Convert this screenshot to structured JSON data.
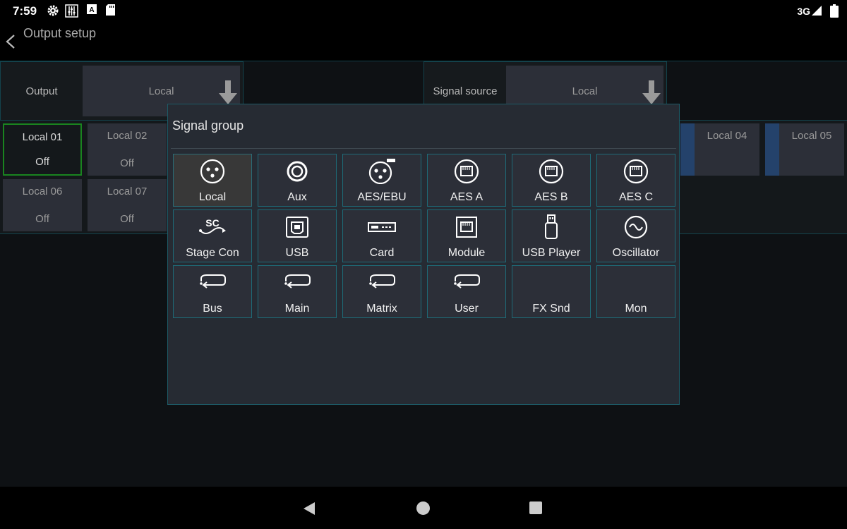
{
  "status_bar": {
    "time": "7:59",
    "network": "3G",
    "icons": [
      "gear-icon",
      "mixer-icon",
      "a-icon",
      "sdcard-icon",
      "signal-icon",
      "battery-icon"
    ]
  },
  "app_bar": {
    "title": "Output setup"
  },
  "output_selector": {
    "label": "Output",
    "value": "Local"
  },
  "source_selector": {
    "label": "Signal source",
    "value": "Local"
  },
  "channels": [
    {
      "name": "Local 01",
      "value": "Off"
    },
    {
      "name": "Local 02",
      "value": "Off"
    },
    {
      "name": "Local 04",
      "value": ""
    },
    {
      "name": "Local 05",
      "value": ""
    },
    {
      "name": "Local 06",
      "value": "Off"
    },
    {
      "name": "Local 07",
      "value": "Off"
    }
  ],
  "dialog": {
    "title": "Signal group",
    "buttons": [
      {
        "label": "Local",
        "icon": "xlr-icon"
      },
      {
        "label": "Aux",
        "icon": "rca-icon"
      },
      {
        "label": "AES/EBU",
        "icon": "xlr-aes-icon"
      },
      {
        "label": "AES A",
        "icon": "ethernet-icon"
      },
      {
        "label": "AES B",
        "icon": "ethernet-icon"
      },
      {
        "label": "AES C",
        "icon": "ethernet-icon"
      },
      {
        "label": "Stage Con",
        "icon": "stage-connect-icon",
        "icon_text": "SC"
      },
      {
        "label": "USB",
        "icon": "usb-b-icon"
      },
      {
        "label": "Card",
        "icon": "card-icon"
      },
      {
        "label": "Module",
        "icon": "module-icon"
      },
      {
        "label": "USB Player",
        "icon": "usb-stick-icon"
      },
      {
        "label": "Oscillator",
        "icon": "oscillator-icon"
      },
      {
        "label": "Bus",
        "icon": "loop-icon"
      },
      {
        "label": "Main",
        "icon": "loop-icon"
      },
      {
        "label": "Matrix",
        "icon": "loop-icon"
      },
      {
        "label": "User",
        "icon": "loop-icon"
      },
      {
        "label": "FX Snd",
        "icon": ""
      },
      {
        "label": "Mon",
        "icon": ""
      }
    ]
  },
  "colors": {
    "accent_border": "#1e6a77",
    "active_green": "#19841f",
    "stripe_blue": "#24426b"
  }
}
